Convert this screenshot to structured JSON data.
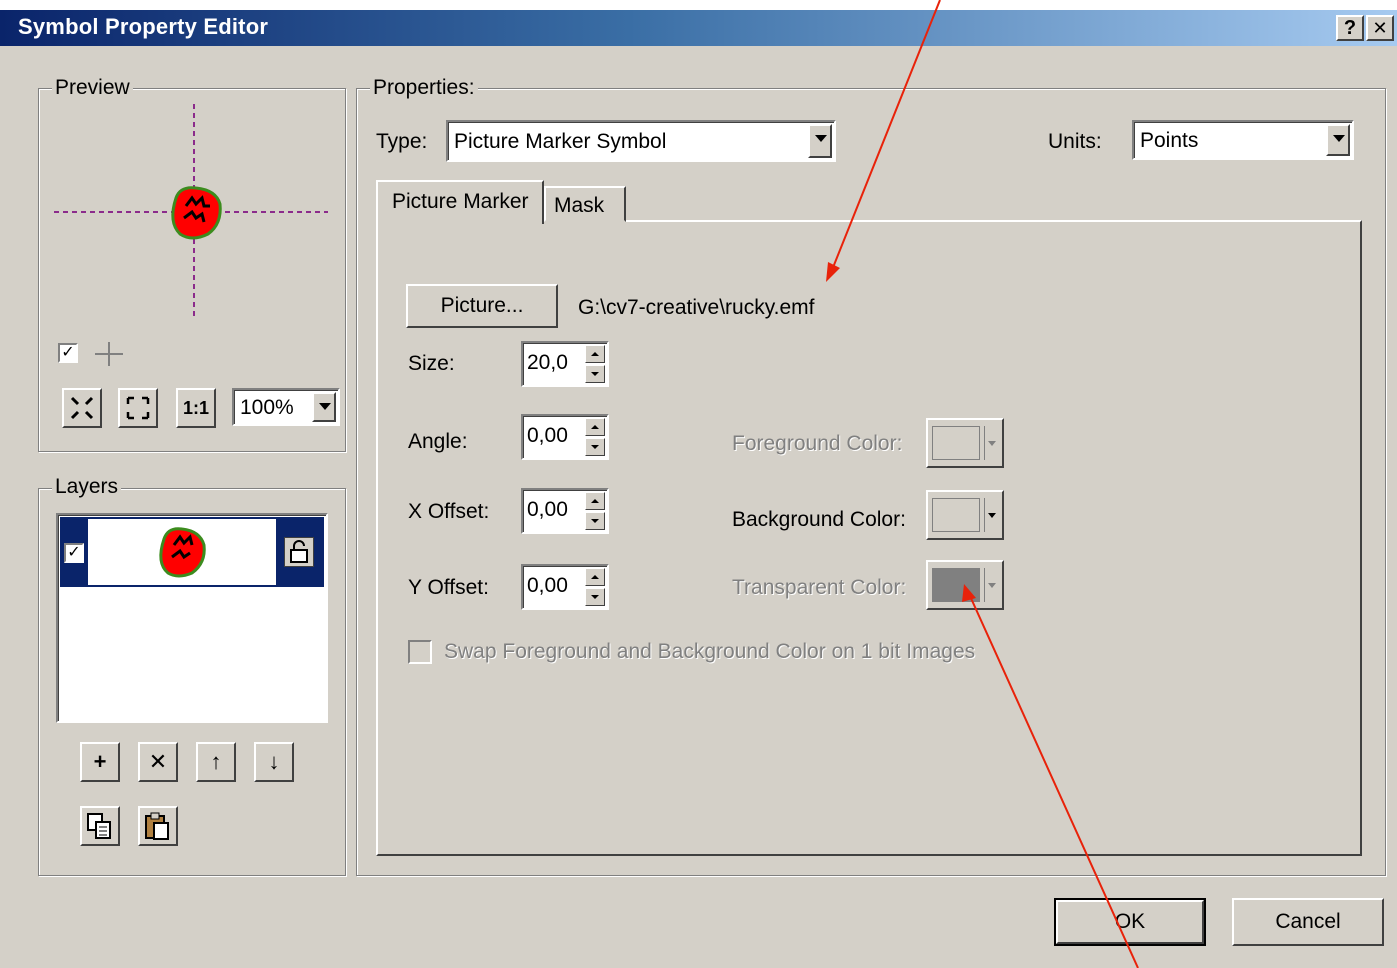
{
  "window": {
    "title": "Symbol Property Editor",
    "help_label": "?",
    "close_label": "✕"
  },
  "preview": {
    "legend": "Preview",
    "show_crosshair_checked": "✓",
    "zoom_value": "100%"
  },
  "layers": {
    "legend": "Layers",
    "row_checked": "✓",
    "buttons": {
      "add": "+",
      "remove": "✕",
      "up": "↑",
      "down": "↓"
    }
  },
  "properties": {
    "legend": "Properties:",
    "type_label": "Type:",
    "type_value": "Picture Marker Symbol",
    "units_label": "Units:",
    "units_value": "Points",
    "tabs": [
      {
        "label": "Picture Marker",
        "active": true
      },
      {
        "label": "Mask",
        "active": false
      }
    ],
    "picture_button": "Picture...",
    "picture_path": "G:\\cv7-creative\\rucky.emf",
    "size_label": "Size:",
    "size_value": "20,0",
    "angle_label": "Angle:",
    "angle_value": "0,00",
    "xoffset_label": "X Offset:",
    "xoffset_value": "0,00",
    "yoffset_label": "Y Offset:",
    "yoffset_value": "0,00",
    "foreground_label": "Foreground Color:",
    "background_label": "Background Color:",
    "transparent_label": "Transparent Color:",
    "transparent_color": "#808080",
    "swap_label": "Swap Foreground and Background Color on 1 bit Images"
  },
  "footer": {
    "ok": "OK",
    "cancel": "Cancel"
  },
  "colors": {
    "face": "#d4d0c8",
    "title_start": "#0a246a",
    "annotation_arrow": "#e8220a",
    "marker_fill": "#ff0000",
    "marker_outline": "#3c8c1e"
  },
  "icons": [
    "zoom-out-icon",
    "zoom-in-icon",
    "actual-size-icon",
    "lock-icon",
    "copy-icon",
    "paste-icon"
  ]
}
